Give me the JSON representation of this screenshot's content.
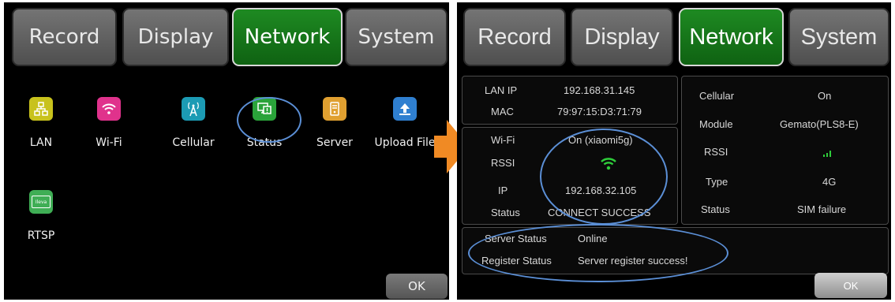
{
  "tabs": [
    "Record",
    "Display",
    "Network",
    "System"
  ],
  "left": {
    "apps": [
      {
        "label": "LAN",
        "icon": "lan-icon",
        "color": "#c8c21c"
      },
      {
        "label": "Wi-Fi",
        "icon": "wifi-icon",
        "color": "#e0328c"
      },
      {
        "label": "Cellular",
        "icon": "cellular-icon",
        "color": "#1c9bb4"
      },
      {
        "label": "Status",
        "icon": "status-icon",
        "color": "#2aa33a"
      },
      {
        "label": "Server",
        "icon": "server-icon",
        "color": "#e0a030"
      },
      {
        "label": "Upload File",
        "icon": "upload-icon",
        "color": "#2f7fd0"
      },
      {
        "label": "RTSP",
        "icon": "rtsp-icon",
        "color": "#3fae55"
      }
    ],
    "rtsp_icon_text": "Ileva",
    "ok_label": "OK"
  },
  "right": {
    "lan": {
      "ip_label": "LAN IP",
      "ip": "192.168.31.145",
      "mac_label": "MAC",
      "mac": "79:97:15:D3:71:79"
    },
    "wifi": {
      "wifi_label": "Wi-Fi",
      "wifi_value": "On (xiaomi5g)",
      "rssi_label": "RSSI",
      "ip_label": "IP",
      "ip": "192.168.32.105",
      "status_label": "Status",
      "status": "CONNECT SUCCESS"
    },
    "cellular": {
      "cellular_label": "Cellular",
      "cellular_value": "On",
      "module_label": "Module",
      "module_value": "Gemato(PLS8-E)",
      "rssi_label": "RSSI",
      "type_label": "Type",
      "type_value": "4G",
      "status_label": "Status",
      "status_value": "SIM failure"
    },
    "server": {
      "server_status_label": "Server Status",
      "server_status": "Online",
      "register_label": "Register Status",
      "register_status": "Server register success!"
    },
    "ok_label": "OK"
  },
  "colors": {
    "active_tab": "#137a18",
    "ellipse": "#5b8fd6",
    "arrow": "#f08a24",
    "wifi_green": "#2ecc3a"
  }
}
